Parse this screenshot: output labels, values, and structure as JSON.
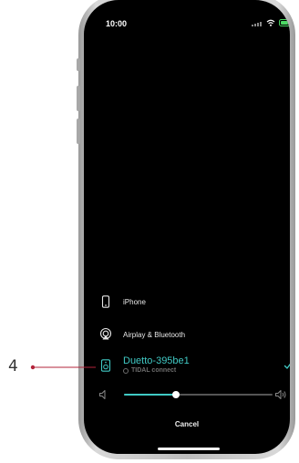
{
  "callout": {
    "number": "4",
    "color": "#b3243b"
  },
  "status_bar": {
    "time": "10:00",
    "signal_icon": "signal-icon",
    "wifi_icon": "wifi-icon",
    "battery_icon": "battery-icon",
    "battery_color": "#4cd964"
  },
  "devices": [
    {
      "label": "iPhone",
      "icon": "phone-icon"
    },
    {
      "label": "Airplay & Bluetooth",
      "icon": "airplay-icon"
    }
  ],
  "selected_device": {
    "name": "Duetto-395be1",
    "subtitle": "TIDAL connect",
    "icon": "speaker-icon",
    "check_icon": "check-icon",
    "accent": "#40c9c4"
  },
  "volume": {
    "level": 0.35,
    "low_icon": "volume-low-icon",
    "high_icon": "volume-high-icon"
  },
  "cancel_label": "Cancel"
}
